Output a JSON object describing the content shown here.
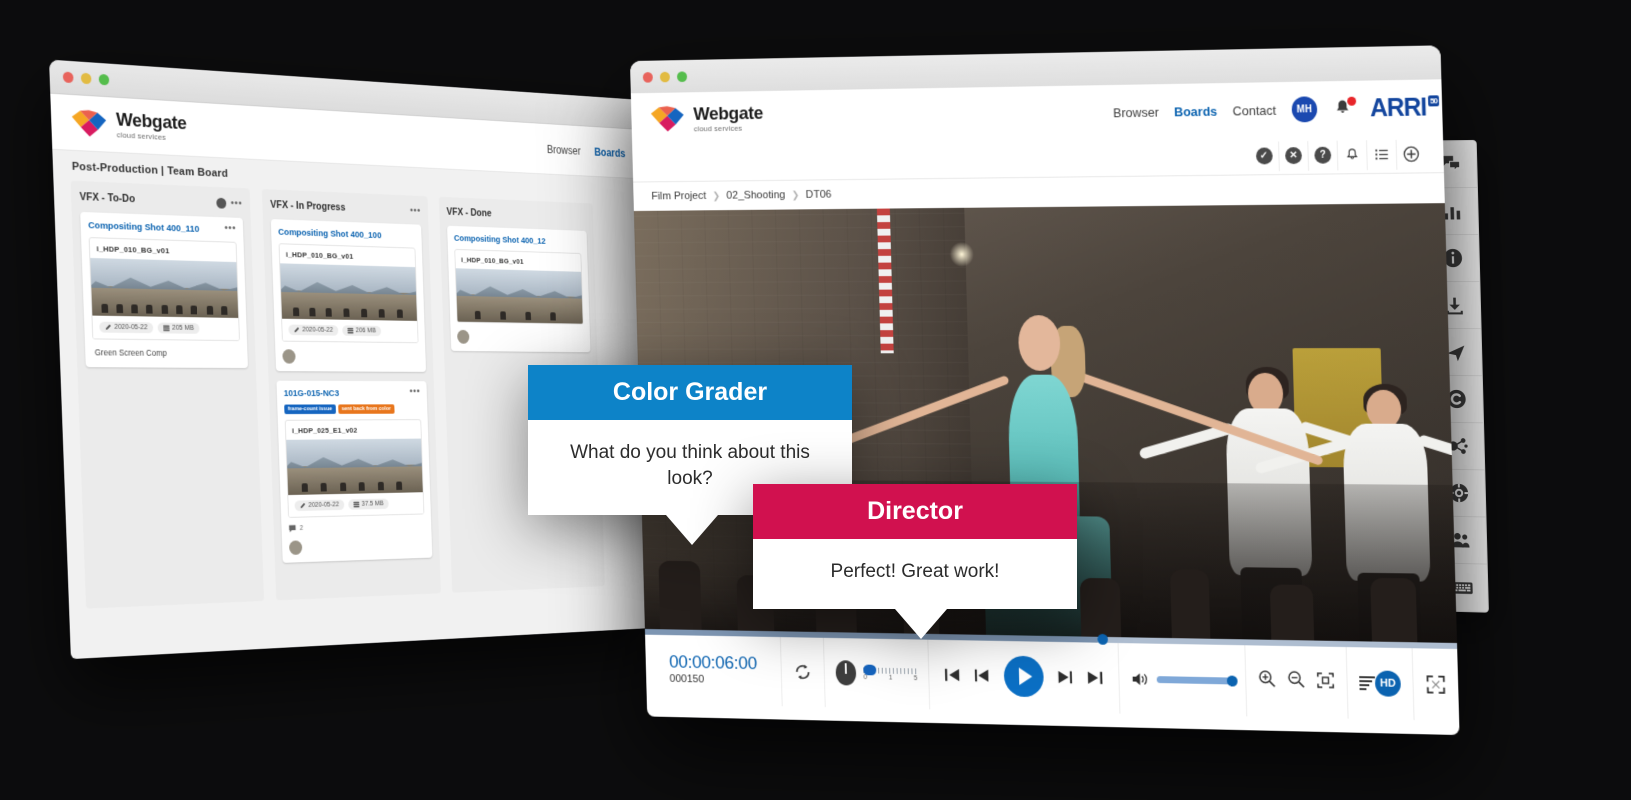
{
  "brand": {
    "name": "Webgate",
    "tagline": "cloud services",
    "partner_logo": "ARRI",
    "partner_sup": "50"
  },
  "colors": {
    "accent_blue": "#0b63b0",
    "grader_blue": "#0d83c8",
    "director_crimson": "#d1114f",
    "arri_blue": "#14469e",
    "notification_red": "#e8262a"
  },
  "back_window": {
    "window_controls": [
      "close",
      "minimize",
      "maximize"
    ],
    "nav": [
      {
        "label": "Browser",
        "active": false
      },
      {
        "label": "Boards",
        "active": true
      }
    ],
    "board_title": "Post-Production | Team Board",
    "columns": [
      {
        "title": "VFX - To-Do",
        "cards": [
          {
            "title": "Compositing Shot 400_110",
            "asset_name": "i_HDP_010_BG_v01",
            "date": "2020-05-22",
            "size": "205 MB",
            "footer": "Green Screen Comp",
            "tags": []
          }
        ]
      },
      {
        "title": "VFX - In Progress",
        "cards": [
          {
            "title": "Compositing Shot 400_100",
            "asset_name": "i_HDP_010_BG_v01",
            "date": "2020-05-22",
            "size": "206 MB",
            "footer": "",
            "tags": []
          },
          {
            "title": "101G-015-NC3",
            "asset_name": "i_HDP_025_E1_v02",
            "date": "2020-05-22",
            "size": "37.5 MB",
            "footer": "",
            "comment_count": "2",
            "tags": [
              {
                "label": "frame-count issue",
                "color": "blue"
              },
              {
                "label": "sent back from color",
                "color": "orange"
              }
            ]
          }
        ]
      },
      {
        "title": "VFX - Done",
        "cards": [
          {
            "title": "Compositing Shot 400_12",
            "asset_name": "i_HDP_010_BG_v01",
            "date": "",
            "size": "",
            "footer": "",
            "tags": []
          }
        ]
      }
    ]
  },
  "front_window": {
    "window_controls": [
      "close",
      "minimize",
      "maximize"
    ],
    "nav": [
      {
        "label": "Browser",
        "active": false
      },
      {
        "label": "Boards",
        "active": true
      },
      {
        "label": "Contact",
        "active": false
      }
    ],
    "avatar_initials": "MH",
    "toolbar_icons": [
      "check-circle-icon",
      "close-circle-icon",
      "help-circle-icon",
      "bell-icon",
      "list-icon",
      "plus-circle-icon"
    ],
    "breadcrumb": [
      "Film Project",
      "02_Shooting",
      "DT06"
    ],
    "player": {
      "timecode": "00:00:06:00",
      "frame": "000150",
      "loop_icon": "loop-icon",
      "shuttle_scale": [
        "0",
        "1",
        "5"
      ],
      "transport": [
        "skip-start-icon",
        "step-back-icon",
        "play-icon",
        "step-forward-icon",
        "skip-end-icon"
      ],
      "volume_icon": "volume-icon",
      "zoom_in_icon": "zoom-in-icon",
      "zoom_out_icon": "zoom-out-icon",
      "fit_icon": "fit-screen-icon",
      "quality_badge": "HD",
      "fullscreen_icon": "fullscreen-icon",
      "progress_percent": "57"
    }
  },
  "rail": {
    "items": [
      {
        "name": "comments-icon",
        "label": "Comments"
      },
      {
        "name": "bar-chart-icon",
        "label": "Statistics"
      },
      {
        "name": "info-icon",
        "label": "Info"
      },
      {
        "name": "download-icon",
        "label": "Download"
      },
      {
        "name": "send-icon",
        "label": "Send"
      },
      {
        "name": "copyright-icon",
        "label": "Copyright"
      },
      {
        "name": "share-icon",
        "label": "Share"
      },
      {
        "name": "lifebuoy-icon",
        "label": "Support"
      },
      {
        "name": "users-icon",
        "label": "Users"
      },
      {
        "name": "keyboard-icon",
        "label": "Shortcuts"
      }
    ]
  },
  "bubbles": [
    {
      "role": "Color Grader",
      "message": "What do you think about this look?",
      "header_color": "#0d83c8"
    },
    {
      "role": "Director",
      "message": "Perfect! Great work!",
      "header_color": "#d1114f"
    }
  ]
}
